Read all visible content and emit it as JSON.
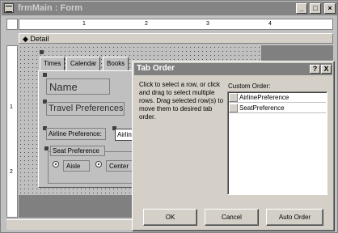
{
  "window": {
    "title": "frmMain : Form"
  },
  "ruler": {
    "h_numbers": [
      "1",
      "2",
      "3",
      "4"
    ],
    "v_numbers": [
      "1",
      "2"
    ]
  },
  "section": {
    "detail": "Detail"
  },
  "tabs": [
    "Times",
    "Calendar",
    "Books"
  ],
  "form": {
    "name_label": "Name",
    "travel_label": "Travel Preferences",
    "airline_label": "Airline Preference:",
    "airline_field": "Airline",
    "seat_group": "Seat Preference",
    "aisle": "Aisle",
    "center": "Center"
  },
  "dialog": {
    "title": "Tab Order",
    "help": "?",
    "close": "X",
    "instructions": "Click to select a row, or click and drag to select multiple rows. Drag selected row(s) to move them to desired tab order.",
    "custom_order_label": "Custom Order:",
    "items": [
      "AirlinePreference",
      "SeatPreference"
    ],
    "ok": "OK",
    "cancel": "Cancel",
    "auto_order": "Auto Order"
  }
}
